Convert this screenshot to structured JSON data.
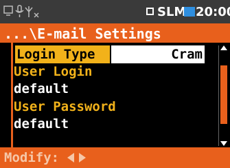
{
  "status": {
    "mode": "SLM",
    "time": "20:00",
    "icons": [
      "display-icon",
      "microphone-icon",
      "signal-icon"
    ]
  },
  "header": {
    "title": "...\\E-mail Settings"
  },
  "settings": {
    "selected": {
      "label": "Login Type",
      "value": "Cram"
    },
    "items": [
      {
        "label": "User Login",
        "value": "default"
      },
      {
        "label": "User Password",
        "value": "default"
      }
    ]
  },
  "footer": {
    "modify_label": "Modify:"
  },
  "colors": {
    "accent": "#e8601c",
    "label": "#f2b21a",
    "status_bg": "#3a3a3a",
    "battery": "#2f8fe0"
  }
}
